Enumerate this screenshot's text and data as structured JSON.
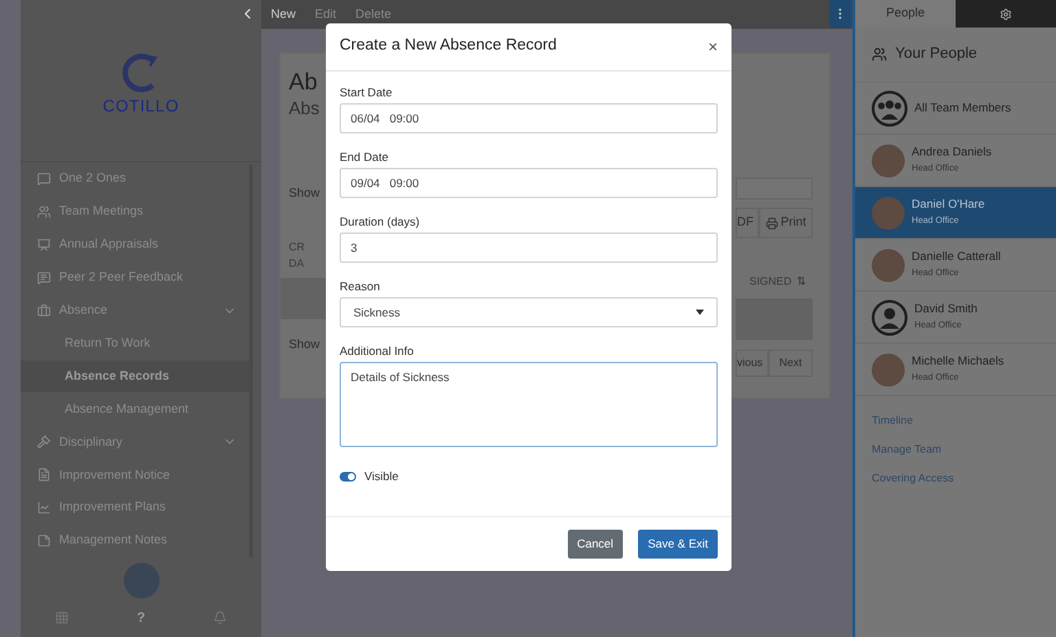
{
  "sidebar": {
    "logo_text": "COTILLO",
    "nav_items": [
      {
        "label": "One 2 Ones",
        "kind": "item",
        "selected": false
      },
      {
        "label": "Team Meetings",
        "kind": "item",
        "selected": false
      },
      {
        "label": "Annual Appraisals",
        "kind": "item",
        "selected": false
      },
      {
        "label": "Peer 2 Peer Feedback",
        "kind": "item",
        "selected": false
      },
      {
        "label": "Absence",
        "kind": "group",
        "selected": false
      },
      {
        "label": "Return To Work",
        "kind": "sub",
        "selected": false
      },
      {
        "label": "Absence Records",
        "kind": "sub",
        "selected": true
      },
      {
        "label": "Absence Management",
        "kind": "sub",
        "selected": false
      },
      {
        "label": "Disciplinary",
        "kind": "group",
        "selected": false
      },
      {
        "label": "Improvement Notice",
        "kind": "item",
        "selected": false
      },
      {
        "label": "Improvement Plans",
        "kind": "item",
        "selected": false
      },
      {
        "label": "Management Notes",
        "kind": "item",
        "selected": false
      }
    ],
    "help_label": "?"
  },
  "toolbar": {
    "actions": [
      "New",
      "Edit",
      "Delete"
    ]
  },
  "background_card": {
    "title_fragment": "Ab",
    "subtitle_fragment": "Abs",
    "show_top": "Show",
    "column_fragment_1": "CR",
    "column_fragment_2": "DA",
    "show_bottom": "Show",
    "button_fragment": "DF",
    "print_button": "Print",
    "signed_column": "SIGNED",
    "sort_icon": "⇅",
    "previous_fragment": "vious",
    "next_button": "Next"
  },
  "modal": {
    "title": "Create a New Absence Record",
    "close": "×",
    "fields": [
      {
        "kind": "input",
        "label": "Start Date",
        "value": "06/04   09:00"
      },
      {
        "kind": "input",
        "label": "End Date",
        "value": "09/04   09:00"
      },
      {
        "kind": "input",
        "label": "Duration (days)",
        "value": "3"
      },
      {
        "kind": "select",
        "label": "Reason",
        "value": "Sickness"
      },
      {
        "kind": "textarea",
        "label": "Additional Info",
        "value": "Details of Sickness"
      }
    ],
    "visible_toggle": {
      "label": "Visible",
      "on": true
    },
    "buttons": [
      {
        "label": "Cancel",
        "kind": "secondary"
      },
      {
        "label": "Save & Exit",
        "kind": "primary"
      }
    ]
  },
  "right_panel": {
    "tabs": [
      {
        "label": "People",
        "kind": "text",
        "selected": true
      },
      {
        "kind": "gear",
        "selected": false
      }
    ],
    "heading": "Your People",
    "people": [
      {
        "name": "All Team Members",
        "kind": "group",
        "selected": false
      },
      {
        "name": "Andrea Daniels",
        "office": "Head Office",
        "kind": "photo",
        "selected": false
      },
      {
        "name": "Daniel O'Hare",
        "office": "Head Office",
        "kind": "photo",
        "selected": true
      },
      {
        "name": "Danielle Catterall",
        "office": "Head Office",
        "kind": "photo",
        "selected": false
      },
      {
        "name": "David Smith",
        "office": "Head Office",
        "kind": "user",
        "selected": false
      },
      {
        "name": "Michelle Michaels",
        "office": "Head Office",
        "kind": "photo",
        "selected": false
      }
    ],
    "links": [
      "Timeline",
      "Manage Team",
      "Covering Access"
    ]
  }
}
